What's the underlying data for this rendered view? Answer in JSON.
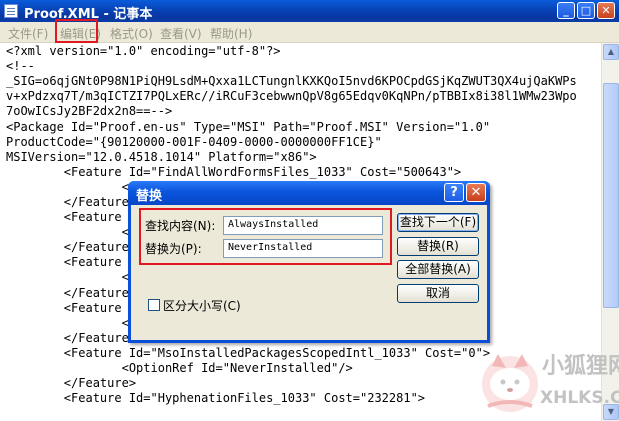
{
  "window": {
    "title": "Proof.XML - 记事本",
    "minimize_glyph": "_",
    "maximize_glyph": "□",
    "close_glyph": "✕"
  },
  "menu": [
    {
      "label": "文件(F)"
    },
    {
      "label": "编辑(E)"
    },
    {
      "label": "格式(O)"
    },
    {
      "label": "查看(V)"
    },
    {
      "label": "帮助(H)"
    }
  ],
  "editor": {
    "lines": [
      "<?xml version=\"1.0\" encoding=\"utf-8\"?>",
      "<!--",
      "_SIG=o6qjGNt0P98N1PiQH9LsdM+Qxxa1LCTungnlKXKQoI5nvd6KPOCpdGSjKqZWUT3QX4ujQaKWPs",
      "v+xPdzxq7T/m3qICTZI7PQLxERc//iRCuF3cebwwnQpV8g65Edqv0KqNPn/pTBBIx8i38l1WMw23Wpo",
      "7oOwICsJy2BF2dx2n8==-->",
      "<Package Id=\"Proof.en-us\" Type=\"MSI\" Path=\"Proof.MSI\" Version=\"1.0\"",
      "ProductCode=\"{90120000-001F-0409-0000-0000000FF1CE}\"",
      "MSIVersion=\"12.0.4518.1014\" Platform=\"x86\">",
      "        <Feature Id=\"FindAllWordFormsFiles_1033\" Cost=\"500643\">",
      "                <",
      "        </Feature>",
      "        <Feature",
      "                <",
      "        </Feature>",
      "        <Feature                                             \">",
      "                <",
      "        </Feature>",
      "        <Feature",
      "                <",
      "        </Feature>",
      "        <Feature Id=\"MsoInstalledPackagesScopedIntl_1033\" Cost=\"0\">",
      "                <OptionRef Id=\"NeverInstalled\"/>",
      "        </Feature>",
      "        <Feature Id=\"HyphenationFiles_1033\" Cost=\"232281\">"
    ]
  },
  "dialog": {
    "title": "替换",
    "help_glyph": "?",
    "close_glyph": "✕",
    "find_label": "查找内容(N):",
    "find_value": "AlwaysInstalled",
    "replace_label": "替换为(P):",
    "replace_value": "NeverInstalled",
    "match_case_label": "区分大小写(C)",
    "buttons": {
      "find_next": "查找下一个(F)",
      "replace": "替换(R)",
      "replace_all": "全部替换(A)",
      "cancel": "取消"
    }
  },
  "watermark": {
    "title": "小狐狸网",
    "url": "XHLKS.CN"
  },
  "colors": {
    "titlebar": "#0842b6",
    "highlight_box": "#e01820",
    "menubar": "#ece9d8"
  }
}
